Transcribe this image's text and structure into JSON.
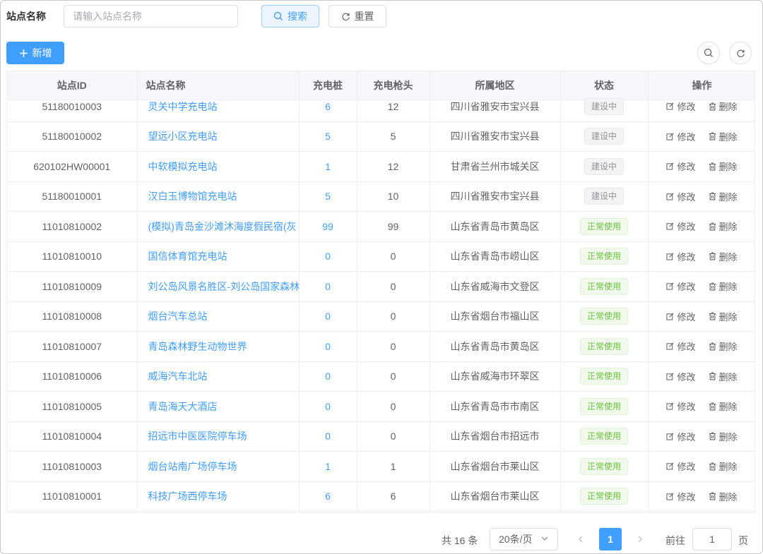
{
  "search": {
    "label": "站点名称",
    "placeholder": "请输入站点名称",
    "search_btn": "搜索",
    "reset_btn": "重置"
  },
  "toolbar": {
    "add_btn": "新增"
  },
  "table": {
    "headers": [
      "站点ID",
      "站点名称",
      "充电桩",
      "充电枪头",
      "所属地区",
      "状态",
      "操作"
    ],
    "rows": [
      {
        "id": "51180010003",
        "name": "灵关中学充电站",
        "piles": "6",
        "guns": "12",
        "region": "四川省雅安市宝兴县",
        "status": "建设中",
        "status_type": "build"
      },
      {
        "id": "51180010002",
        "name": "望远小区充电站",
        "piles": "5",
        "guns": "5",
        "region": "四川省雅安市宝兴县",
        "status": "建设中",
        "status_type": "build"
      },
      {
        "id": "620102HW00001",
        "name": "中软模拟充电站",
        "piles": "1",
        "guns": "12",
        "region": "甘肃省兰州市城关区",
        "status": "建设中",
        "status_type": "build"
      },
      {
        "id": "51180010001",
        "name": "汉白玉博物馆充电站",
        "piles": "5",
        "guns": "10",
        "region": "四川省雅安市宝兴县",
        "status": "建设中",
        "status_type": "build"
      },
      {
        "id": "11010810002",
        "name": "(模拟)青岛金沙滩沐海度假民宿(灰",
        "piles": "99",
        "guns": "99",
        "region": "山东省青岛市黄岛区",
        "status": "正常使用",
        "status_type": "ok"
      },
      {
        "id": "11010810010",
        "name": "国信体育馆充电站",
        "piles": "0",
        "guns": "0",
        "region": "山东省青岛市崂山区",
        "status": "正常使用",
        "status_type": "ok"
      },
      {
        "id": "11010810009",
        "name": "刘公岛风景名胜区-刘公岛国家森林",
        "piles": "0",
        "guns": "0",
        "region": "山东省威海市文登区",
        "status": "正常使用",
        "status_type": "ok"
      },
      {
        "id": "11010810008",
        "name": "烟台汽车总站",
        "piles": "0",
        "guns": "0",
        "region": "山东省烟台市福山区",
        "status": "正常使用",
        "status_type": "ok"
      },
      {
        "id": "11010810007",
        "name": "青岛森林野生动物世界",
        "piles": "0",
        "guns": "0",
        "region": "山东省青岛市黄岛区",
        "status": "正常使用",
        "status_type": "ok"
      },
      {
        "id": "11010810006",
        "name": "威海汽车北站",
        "piles": "0",
        "guns": "0",
        "region": "山东省威海市环翠区",
        "status": "正常使用",
        "status_type": "ok"
      },
      {
        "id": "11010810005",
        "name": "青岛海天大酒店",
        "piles": "0",
        "guns": "0",
        "region": "山东省青岛市市南区",
        "status": "正常使用",
        "status_type": "ok"
      },
      {
        "id": "11010810004",
        "name": "招远市中医医院停车场",
        "piles": "0",
        "guns": "0",
        "region": "山东省烟台市招远市",
        "status": "正常使用",
        "status_type": "ok"
      },
      {
        "id": "11010810003",
        "name": "烟台站南广场停车场",
        "piles": "1",
        "guns": "1",
        "region": "山东省烟台市莱山区",
        "status": "正常使用",
        "status_type": "ok"
      },
      {
        "id": "11010810001",
        "name": "科技广场西停车场",
        "piles": "6",
        "guns": "6",
        "region": "山东省烟台市莱山区",
        "status": "正常使用",
        "status_type": "ok"
      }
    ],
    "edit_label": "修改",
    "delete_label": "删除"
  },
  "pagination": {
    "total": "共 16 条",
    "page_size": "20条/页",
    "current_page": "1",
    "goto_label": "前往",
    "goto_value": "1",
    "goto_suffix": "页"
  },
  "colors": {
    "primary": "#409eff",
    "success": "#67c23a",
    "info": "#909399"
  }
}
